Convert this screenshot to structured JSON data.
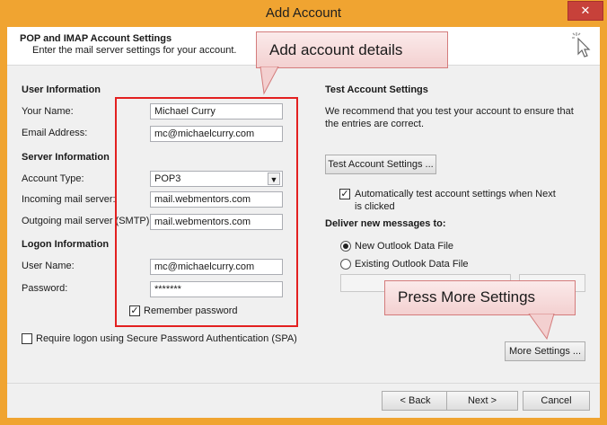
{
  "window": {
    "title": "Add Account",
    "close_glyph": "✕"
  },
  "header": {
    "title": "POP and IMAP Account Settings",
    "subtitle": "Enter the mail server settings for your account."
  },
  "user_info": {
    "heading": "User Information",
    "name_label": "Your Name:",
    "name_value": "Michael Curry",
    "email_label": "Email Address:",
    "email_value": "mc@michaelcurry.com"
  },
  "server_info": {
    "heading": "Server Information",
    "account_type_label": "Account Type:",
    "account_type_value": "POP3",
    "incoming_label": "Incoming mail server:",
    "incoming_value": "mail.webmentors.com",
    "outgoing_label": "Outgoing mail server (SMTP):",
    "outgoing_value": "mail.webmentors.com"
  },
  "logon_info": {
    "heading": "Logon Information",
    "username_label": "User Name:",
    "username_value": "mc@michaelcurry.com",
    "password_label": "Password:",
    "password_value": "*******",
    "remember_label": "Remember password",
    "remember_checked": true,
    "spa_label": "Require logon using Secure Password Authentication (SPA)",
    "spa_checked": false
  },
  "test_settings": {
    "heading": "Test Account Settings",
    "description": "We recommend that you test your account to ensure that the entries are correct.",
    "test_button": "Test Account Settings ...",
    "auto_test_label": "Automatically test account settings when Next is clicked",
    "auto_test_checked": true
  },
  "deliver": {
    "heading": "Deliver new messages to:",
    "option_new": "New Outlook Data File",
    "option_existing": "Existing Outlook Data File",
    "selected": "new"
  },
  "more_settings_button": "More Settings ...",
  "callouts": {
    "top": "Add account details",
    "bottom": "Press More Settings"
  },
  "footer": {
    "back_button": "< Back",
    "next_button": "Next >",
    "cancel_button": "Cancel"
  },
  "colors": {
    "title_bar": "#f0a431",
    "close_button": "#c7413a",
    "highlight_border": "#e32020",
    "callout_fill": "#f3d0d0"
  },
  "icons": {
    "header_icon": "pointer-sparkle-icon",
    "dropdown": "chevron-down-icon"
  }
}
